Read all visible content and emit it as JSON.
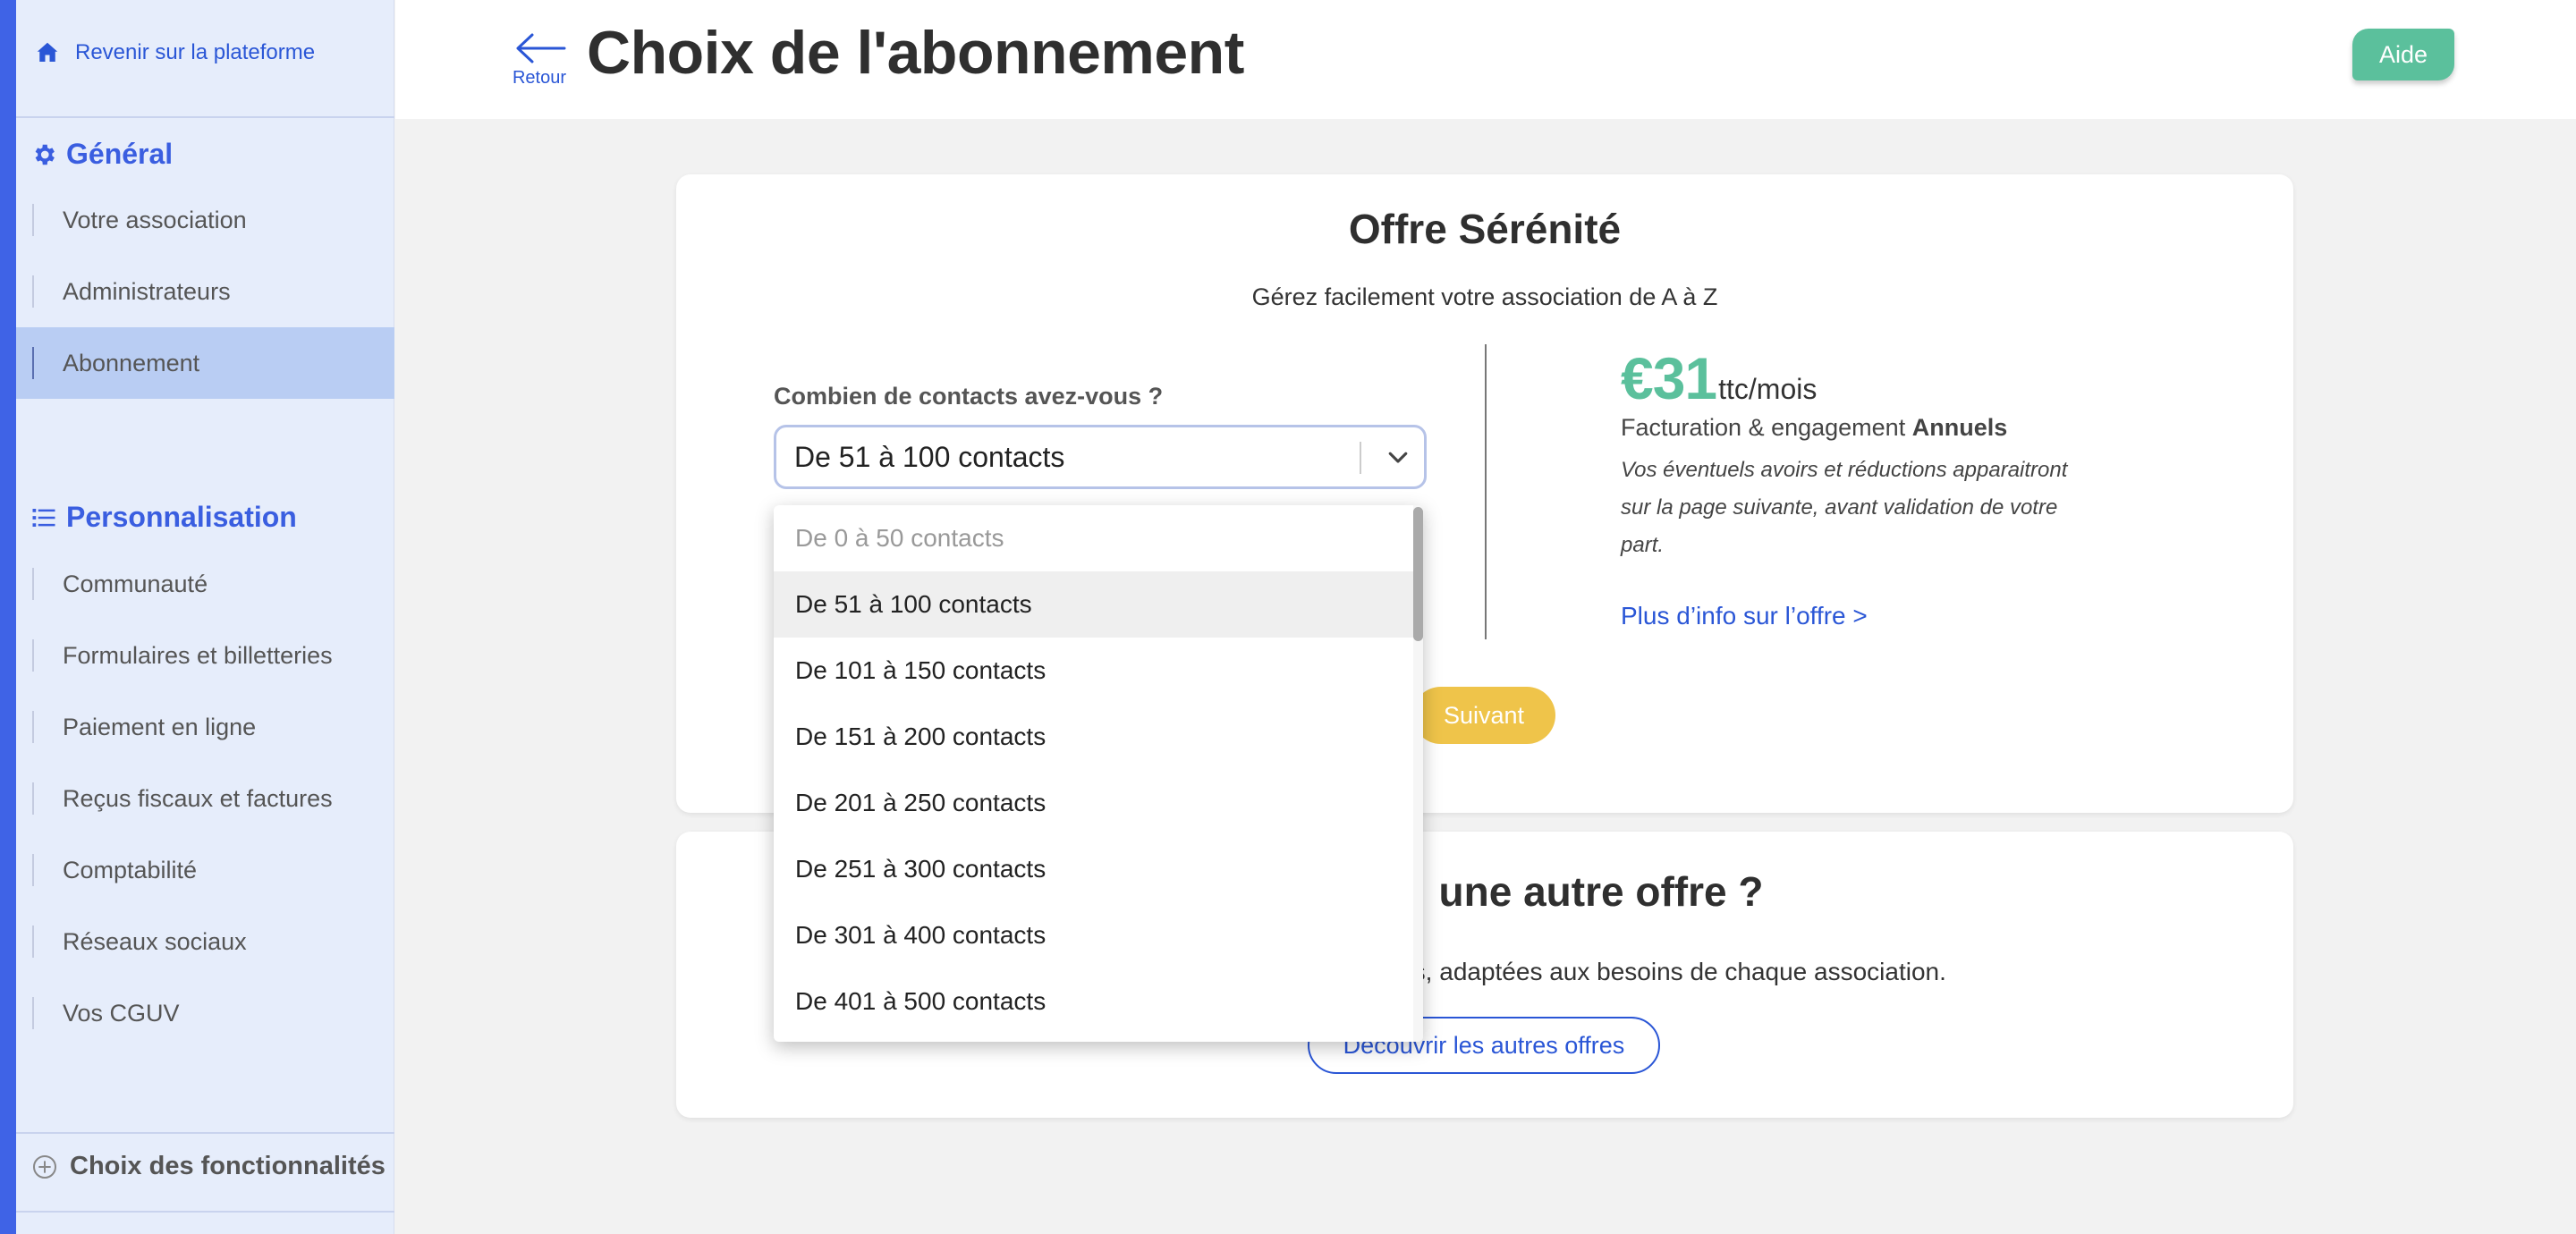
{
  "sidebar": {
    "back_label": "Revenir sur la plateforme",
    "sections": [
      {
        "title": "Général",
        "items": [
          "Votre association",
          "Administrateurs",
          "Abonnement"
        ]
      },
      {
        "title": "Personnalisation",
        "items": [
          "Communauté",
          "Formulaires et billetteries",
          "Paiement en ligne",
          "Reçus fiscaux et factures",
          "Comptabilité",
          "Réseaux sociaux",
          "Vos CGUV"
        ]
      }
    ],
    "active_item": "Abonnement",
    "features_label": "Choix des fonctionnalités"
  },
  "header": {
    "back_label": "Retour",
    "title": "Choix de l'abonnement",
    "help_label": "Aide"
  },
  "offer": {
    "title": "Offre Sérénité",
    "subtitle": "Gérez facilement votre association de A à Z",
    "question": "Combien de contacts avez-vous ?",
    "selected_option": "De 51 à 100 contacts",
    "price_amount": "€31",
    "price_unit": "ttc/mois",
    "billing_prefix": "Facturation & engagement",
    "billing_strong": "Annuels",
    "note": "Vos éventuels avoirs et réductions apparaitront sur la page suivante, avant validation de votre part.",
    "more_info": "Plus d’info sur l’offre >",
    "next_label": "Suivant"
  },
  "other_offer": {
    "title_visible": "une autre offre ?",
    "subtitle_visible": "es, adaptées aux besoins de chaque association.",
    "button_label": "Découvrir les autres offres"
  },
  "dropdown": {
    "options": [
      "De 0 à 50 contacts",
      "De 51 à 100 contacts",
      "De 101 à 150 contacts",
      "De 151 à 200 contacts",
      "De 201 à 250 contacts",
      "De 251 à 300 contacts",
      "De 301 à 400 contacts",
      "De 401 à 500 contacts"
    ],
    "disabled_index": 0,
    "selected_index": 1
  },
  "colors": {
    "accent": "#3f63e6",
    "sidebar_bg": "#e6edfb",
    "active_bg": "#b9cdf3",
    "price_green": "#5bc09c",
    "next_yellow": "#efc44a",
    "link_blue": "#2a56d6"
  },
  "icons": {
    "back_platform": "home-icon",
    "general": "gear-icon",
    "personalisation": "list-icon",
    "features": "plus-circle-icon",
    "retour": "arrow-left-icon",
    "select": "chevron-down-icon"
  }
}
